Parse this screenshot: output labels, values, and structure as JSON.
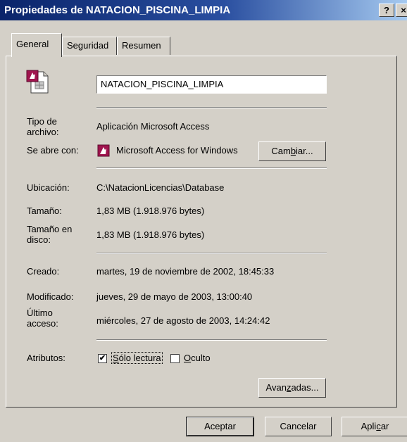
{
  "window": {
    "title": "Propiedades de NATACION_PISCINA_LIMPIA",
    "help_button": "?",
    "close_button": "×"
  },
  "tabs": [
    {
      "label": "General",
      "active": true
    },
    {
      "label": "Seguridad",
      "active": false
    },
    {
      "label": "Resumen",
      "active": false
    }
  ],
  "general": {
    "file_icon": "access-file-icon",
    "filename": "NATACION_PISCINA_LIMPIA",
    "file_type_label": "Tipo de archivo:",
    "file_type_value": "Aplicación Microsoft Access",
    "opens_with_label": "Se abre con:",
    "opens_with_icon": "access-app-icon",
    "opens_with_value": "Microsoft Access for Windows",
    "change_button_pre": "Cam",
    "change_button_mnemonic": "b",
    "change_button_post": "iar...",
    "location_label": "Ubicación:",
    "location_value": "C:\\NatacionLicencias\\Database",
    "size_label": "Tamaño:",
    "size_value": "1,83 MB (1.918.976 bytes)",
    "size_on_disk_label": "Tamaño en disco:",
    "size_on_disk_value": "1,83 MB (1.918.976 bytes)",
    "created_label": "Creado:",
    "created_value": "martes, 19 de noviembre de 2002, 18:45:33",
    "modified_label": "Modificado:",
    "modified_value": "jueves, 29 de mayo de 2003, 13:00:40",
    "accessed_label": "Último acceso:",
    "accessed_value": "miércoles, 27 de agosto de 2003, 14:24:42",
    "attributes_label": "Atributos:",
    "readonly_label": "Sólo lectura",
    "readonly_mnemonic": "S",
    "readonly_rest": "ólo lectura",
    "readonly_checked": true,
    "hidden_label": "Oculto",
    "hidden_mnemonic": "O",
    "hidden_rest": "culto",
    "hidden_checked": false,
    "advanced_button_pre": "Avan",
    "advanced_button_mnemonic": "z",
    "advanced_button_post": "adas..."
  },
  "footer": {
    "ok_label": "Aceptar",
    "cancel_label": "Cancelar",
    "apply_pre": "Apli",
    "apply_mnemonic": "c",
    "apply_post": "ar"
  }
}
